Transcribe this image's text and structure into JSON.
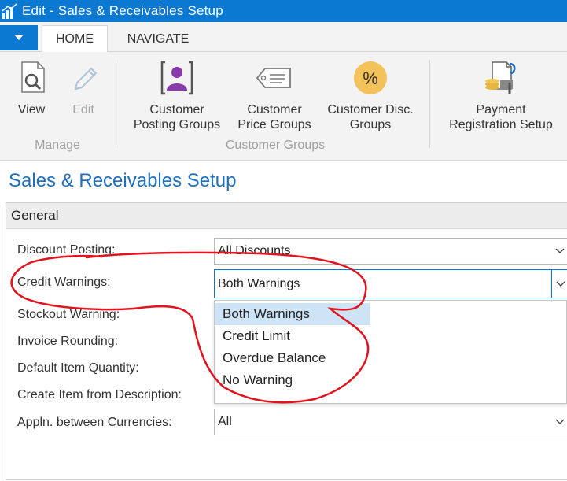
{
  "window": {
    "title": "Edit - Sales & Receivables Setup"
  },
  "tabs": [
    {
      "label": "HOME"
    },
    {
      "label": "NAVIGATE"
    }
  ],
  "ribbon": {
    "manage": {
      "label": "Manage",
      "view": {
        "label": "View",
        "icon": "view-document-icon"
      },
      "edit": {
        "label": "Edit",
        "icon": "pencil-icon"
      }
    },
    "customer_groups": {
      "label": "Customer Groups",
      "posting": {
        "label": [
          "Customer",
          "Posting Groups"
        ],
        "icon": "person-icon"
      },
      "price": {
        "label": [
          "Customer",
          "Price Groups"
        ],
        "icon": "price-tag-icon"
      },
      "disc": {
        "label": [
          "Customer Disc.",
          "Groups"
        ],
        "icon": "percent-icon"
      }
    },
    "payment": {
      "label": [
        "Payment",
        "Registration Setup"
      ],
      "icon": "payment-setup-icon"
    }
  },
  "page_title": "Sales & Receivables Setup",
  "general": {
    "header": "General",
    "fields": {
      "discount_posting": {
        "label": "Discount Posting:",
        "value": "All Discounts"
      },
      "credit_warnings": {
        "label": "Credit Warnings:",
        "value": "Both Warnings"
      },
      "stockout_warning": {
        "label": "Stockout Warning:"
      },
      "invoice_rounding": {
        "label": "Invoice Rounding:"
      },
      "default_item_quantity": {
        "label": "Default Item Quantity:"
      },
      "create_item_from_description": {
        "label": "Create Item from Description:"
      },
      "appln_between_currencies": {
        "label": "Appln. between Currencies:",
        "value": "All"
      }
    },
    "dropdown_options": [
      "Both Warnings",
      "Credit Limit",
      "Overdue Balance",
      "No Warning"
    ]
  },
  "colors": {
    "accent": "#0b78d1",
    "title_blue": "#1f6fbf",
    "annotation": "#e0141e",
    "selected": "#cde4f7"
  }
}
